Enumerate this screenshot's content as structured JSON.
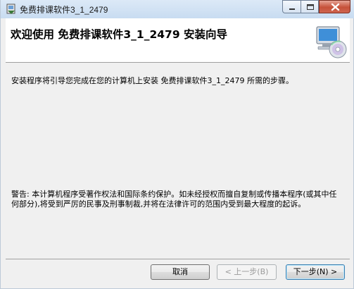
{
  "window": {
    "title": "免费排课软件3_1_2479"
  },
  "header": {
    "heading": "欢迎使用 免费排课软件3_1_2479 安装向导",
    "icon": "setup-computer-cd-icon"
  },
  "content": {
    "intro": "安装程序将引导您完成在您的计算机上安装 免费排课软件3_1_2479 所需的步骤。",
    "warning": "警告: 本计算机程序受著作权法和国际条约保护。如未经授权而擅自复制或传播本程序(或其中任何部分),将受到严厉的民事及刑事制裁,并将在法律许可的范围内受到最大程度的起诉。"
  },
  "buttons": {
    "cancel": "取消",
    "back": "< 上一步(B)",
    "next": "下一步(N) >"
  },
  "colors": {
    "titlebar": "#c8dcf1",
    "close_button": "#c6513a",
    "panel": "#ffffff",
    "body": "#f0f0f0"
  }
}
